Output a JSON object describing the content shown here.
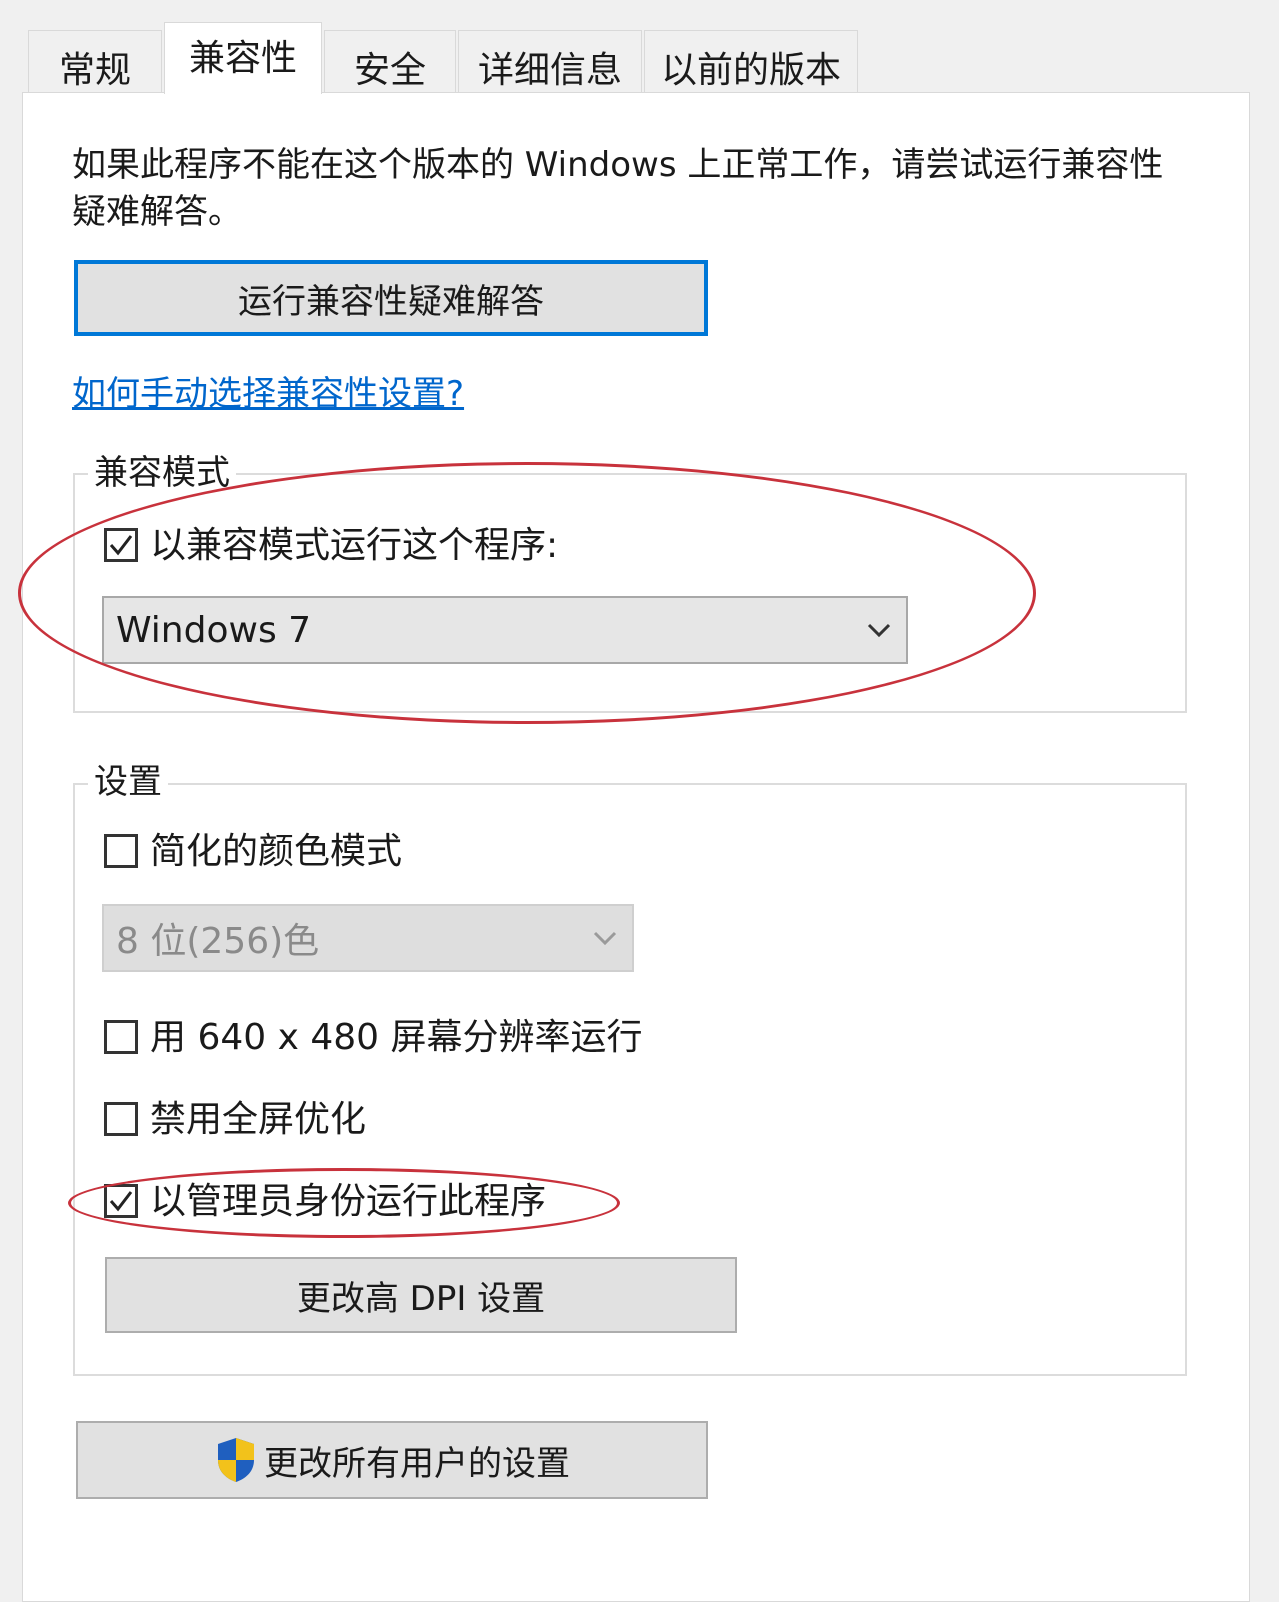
{
  "tabs": [
    {
      "label": "常规"
    },
    {
      "label": "兼容性"
    },
    {
      "label": "安全"
    },
    {
      "label": "详细信息"
    },
    {
      "label": "以前的版本"
    }
  ],
  "description": "如果此程序不能在这个版本的 Windows 上正常工作，请尝试运行兼容性疑难解答。",
  "troubleshoot_button": "运行兼容性疑难解答",
  "help_link": "如何手动选择兼容性设置?",
  "compat_mode": {
    "title": "兼容模式",
    "checkbox_label": "以兼容模式运行这个程序:",
    "checked": true,
    "selected_os": "Windows 7"
  },
  "settings": {
    "title": "设置",
    "reduced_color": {
      "label": "简化的颜色模式",
      "checked": false
    },
    "color_select": "8 位(256)色",
    "res_640": {
      "label": "用 640 x 480 屏幕分辨率运行",
      "checked": false
    },
    "fullscreen_opt": {
      "label": "禁用全屏优化",
      "checked": false
    },
    "run_as_admin": {
      "label": "以管理员身份运行此程序",
      "checked": true
    },
    "dpi_button": "更改高 DPI 设置"
  },
  "all_users_button": "更改所有用户的设置",
  "annotation_color": "#c8323c",
  "accent_color": "#0078d7"
}
